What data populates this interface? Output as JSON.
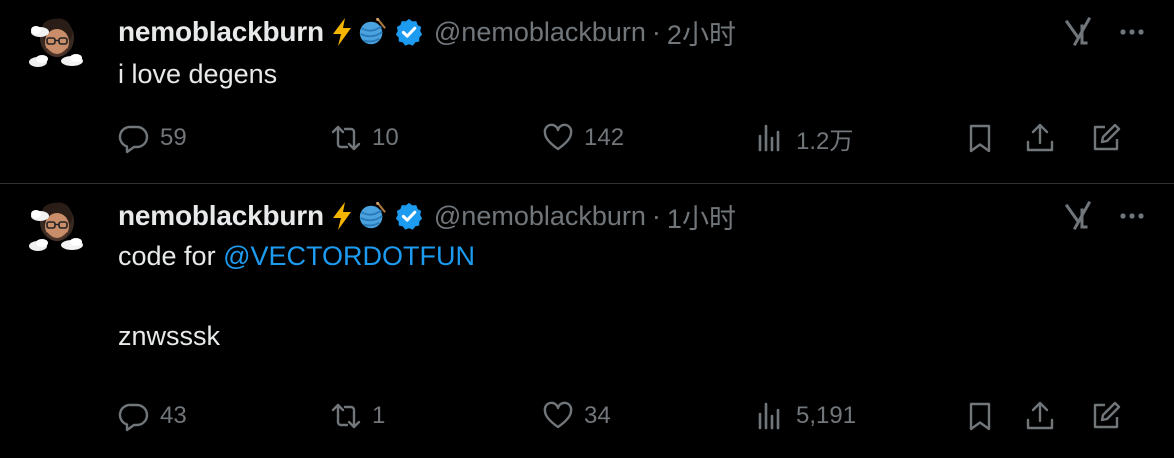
{
  "colors": {
    "background": "#000000",
    "text_primary": "#e7e9ea",
    "text_secondary": "#71767b",
    "link": "#1d9bf0",
    "verified": "#1d9bf0",
    "lightning": "#f5b400",
    "divider": "#2f3336"
  },
  "icons": {
    "reply": "reply-icon",
    "retweet": "retweet-icon",
    "like": "heart-icon",
    "views": "views-icon",
    "bookmark": "bookmark-icon",
    "share": "share-icon",
    "compose": "compose-icon",
    "grok": "grok-icon",
    "more": "more-icon"
  },
  "tweets": [
    {
      "display_name": "nemoblackburn",
      "handle": "@nemoblackburn",
      "separator": "·",
      "time": "2小时",
      "text": "i love degens",
      "mention": "",
      "text_after": "",
      "stats": {
        "replies": "59",
        "retweets": "10",
        "likes": "142",
        "views": "1.2万"
      }
    },
    {
      "display_name": "nemoblackburn",
      "handle": "@nemoblackburn",
      "separator": "·",
      "time": "1小时",
      "text": "code for ",
      "mention": "@VECTORDOTFUN",
      "text_after": "\n\nznwsssk",
      "stats": {
        "replies": "43",
        "retweets": "1",
        "likes": "34",
        "views": "5,191"
      }
    }
  ]
}
